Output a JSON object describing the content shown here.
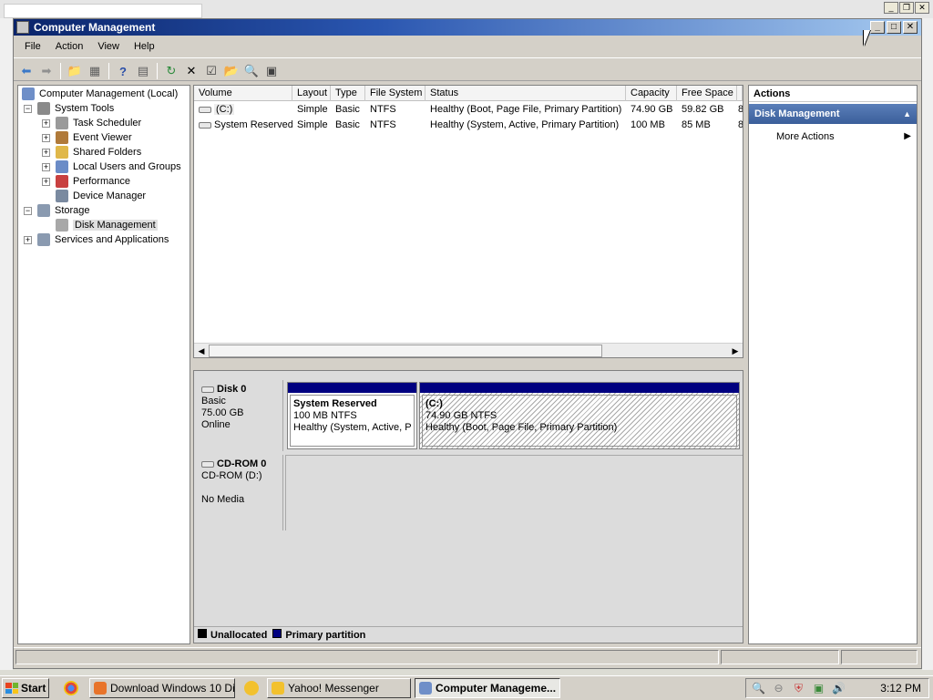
{
  "window": {
    "title": "Computer Management",
    "controls": {
      "minimize": "_",
      "maximize": "□",
      "close": "✕"
    }
  },
  "menu": [
    "File",
    "Action",
    "View",
    "Help"
  ],
  "tree": [
    {
      "label": "Computer Management (Local)",
      "level": 0,
      "expander": "",
      "icon": "computer-icon",
      "color": "#6f8fc8"
    },
    {
      "label": "System Tools",
      "level": 1,
      "expander": "−",
      "icon": "tools-icon",
      "color": "#8a8a8a"
    },
    {
      "label": "Task Scheduler",
      "level": 2,
      "expander": "+",
      "icon": "clock-icon",
      "color": "#9a9a9a"
    },
    {
      "label": "Event Viewer",
      "level": 2,
      "expander": "+",
      "icon": "event-viewer-icon",
      "color": "#b07a3a"
    },
    {
      "label": "Shared Folders",
      "level": 2,
      "expander": "+",
      "icon": "shared-folder-icon",
      "color": "#e0b84a"
    },
    {
      "label": "Local Users and Groups",
      "level": 2,
      "expander": "+",
      "icon": "users-icon",
      "color": "#6b8cc7"
    },
    {
      "label": "Performance",
      "level": 2,
      "expander": "+",
      "icon": "performance-icon",
      "color": "#c84040"
    },
    {
      "label": "Device Manager",
      "level": 2,
      "expander": "",
      "icon": "device-manager-icon",
      "color": "#7a8aa0"
    },
    {
      "label": "Storage",
      "level": 1,
      "expander": "−",
      "icon": "storage-icon",
      "color": "#8a9ab0"
    },
    {
      "label": "Disk Management",
      "level": 2,
      "expander": "",
      "icon": "disk-icon",
      "color": "#a8a8a8",
      "selected": true
    },
    {
      "label": "Services and Applications",
      "level": 1,
      "expander": "+",
      "icon": "services-icon",
      "color": "#8a9ab0",
      "expanderRoot": true
    }
  ],
  "volumes": {
    "columns": [
      "Volume",
      "Layout",
      "Type",
      "File System",
      "Status",
      "Capacity",
      "Free Space",
      ""
    ],
    "rows": [
      {
        "volume": "(C:)",
        "layout": "Simple",
        "type": "Basic",
        "fs": "NTFS",
        "status": "Healthy (Boot, Page File, Primary Partition)",
        "capacity": "74.90 GB",
        "free": "59.82 GB",
        "extra": "8"
      },
      {
        "volume": "System Reserved",
        "layout": "Simple",
        "type": "Basic",
        "fs": "NTFS",
        "status": "Healthy (System, Active, Primary Partition)",
        "capacity": "100 MB",
        "free": "85 MB",
        "extra": "8"
      }
    ]
  },
  "disks": {
    "disk0": {
      "name": "Disk 0",
      "type": "Basic",
      "size": "75.00 GB",
      "state": "Online"
    },
    "cdrom0": {
      "name": "CD-ROM 0",
      "label": "CD-ROM (D:)",
      "media": "No Media"
    },
    "partitions": [
      {
        "name": "System Reserved",
        "size": "100 MB NTFS",
        "status": "Healthy (System, Active, P"
      },
      {
        "name": "(C:)",
        "size": "74.90 GB NTFS",
        "status": "Healthy (Boot, Page File, Primary Partition)"
      }
    ]
  },
  "legend": {
    "unallocated": "Unallocated",
    "unallocated_color": "#000000",
    "primary": "Primary partition",
    "primary_color": "#000080"
  },
  "actions": {
    "title": "Actions",
    "section": "Disk Management",
    "item": "More Actions"
  },
  "taskbar": {
    "start": "Start",
    "tasks": [
      {
        "label": "Download Windows 10 Di...",
        "icon": "firefox-icon",
        "color": "#e8742a"
      },
      {
        "label": "Yahoo! Messenger",
        "icon": "yahoo-messenger-icon",
        "color": "#f2c12e"
      },
      {
        "label": "Computer Manageme...",
        "icon": "computer-management-icon",
        "color": "#6f8fc8",
        "active": true
      }
    ],
    "clock": "3:12 PM"
  },
  "colors": {
    "titlebar": "#0a246a",
    "partition_bar": "#000080",
    "actions_header": "#4a6ea8"
  }
}
